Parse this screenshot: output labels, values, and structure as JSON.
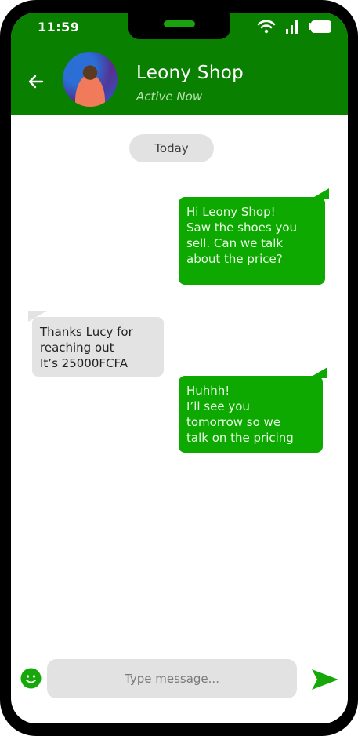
{
  "status_bar": {
    "time": "11:59"
  },
  "header": {
    "contact_name": "Leony Shop",
    "contact_status": "Active Now"
  },
  "date_separator": "Today",
  "messages": [
    {
      "direction": "out",
      "text": "Hi Leony Shop!\nSaw the shoes you\nsell. Can we talk\nabout the price?"
    },
    {
      "direction": "in",
      "text": "Thanks Lucy for\nreaching out\nIt’s 25000FCFA"
    },
    {
      "direction": "out",
      "text": "Huhhh!\nI’ll see you\ntomorrow so we\ntalk on the pricing"
    }
  ],
  "composer": {
    "placeholder": "Type message..."
  },
  "icons": {
    "back": "arrow-left-icon",
    "emoji": "smiley-icon",
    "send": "send-icon",
    "wifi": "wifi-icon",
    "signal": "signal-icon",
    "battery": "battery-icon"
  },
  "colors": {
    "header": "#0a8000",
    "outgoing_bubble": "#0da800",
    "incoming_bubble": "#e3e3e3",
    "accent": "#16a80a"
  }
}
